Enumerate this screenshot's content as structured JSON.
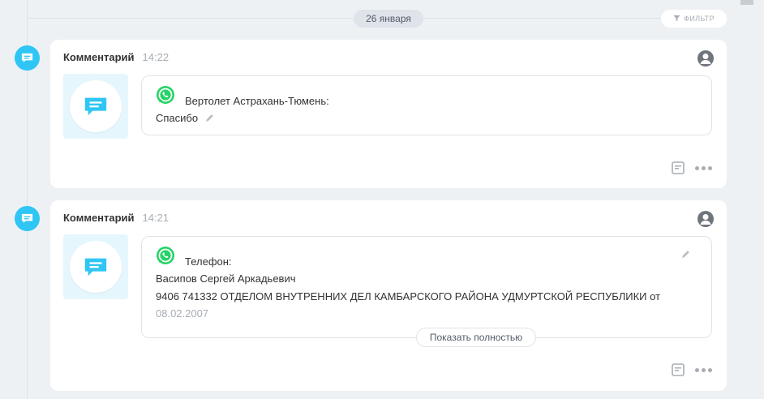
{
  "header": {
    "date": "26 января",
    "filter_label": "ФИЛЬТР"
  },
  "items": [
    {
      "title": "Комментарий",
      "time": "14:22",
      "source_label": "Вертолет Астрахань-Тюмень:",
      "lines": [
        "Спасибо"
      ]
    },
    {
      "title": "Комментарий",
      "time": "14:21",
      "source_label": "Телефон:",
      "lines": [
        "Васипов Сергей Аркадьевич",
        "9406 741332 ОТДЕЛОМ ВНУТРЕННИХ ДЕЛ КАМБАРСКОГО РАЙОНА УДМУРТСКОЙ РЕСПУБЛИКИ от",
        "08.02.2007"
      ],
      "show_full_label": "Показать полностью"
    }
  ],
  "colors": {
    "accent": "#2fc6f6",
    "whatsapp": "#25d366",
    "background": "#eef1f4"
  },
  "icons": [
    "filter-icon",
    "comment-icon",
    "user-icon",
    "whatsapp-icon",
    "pencil-icon",
    "note-icon",
    "more-icon"
  ]
}
